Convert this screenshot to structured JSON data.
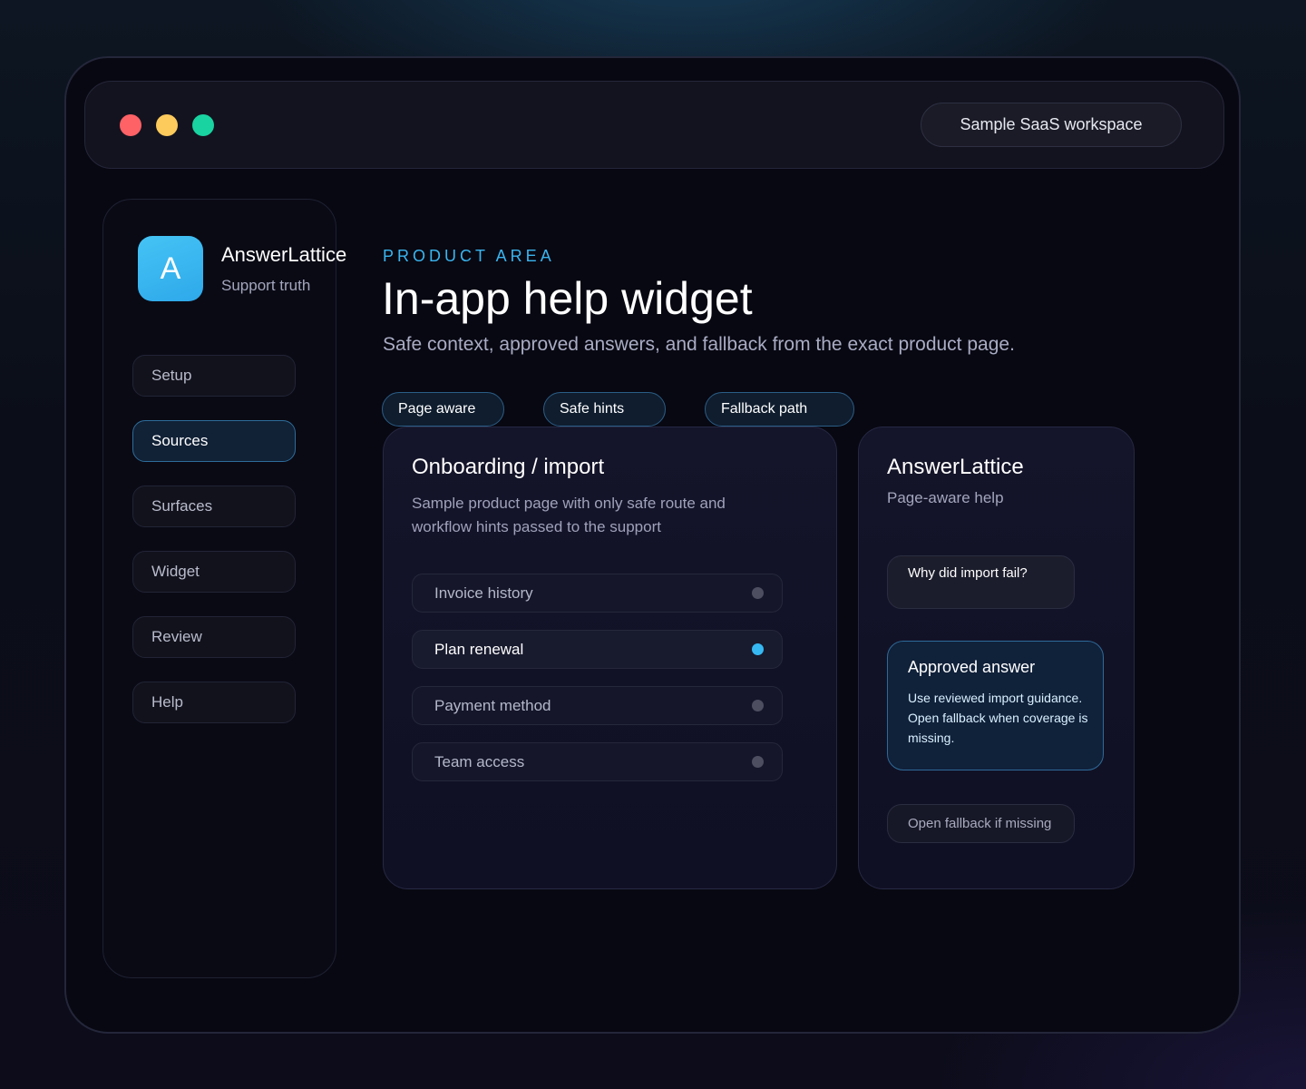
{
  "titlebar": {
    "workspace": "Sample SaaS workspace"
  },
  "brand": {
    "initial": "A",
    "name": "AnswerLattice",
    "tagline": "Support truth"
  },
  "nav": {
    "items": [
      {
        "label": "Setup",
        "active": false
      },
      {
        "label": "Sources",
        "active": true
      },
      {
        "label": "Surfaces",
        "active": false
      },
      {
        "label": "Widget",
        "active": false
      },
      {
        "label": "Review",
        "active": false
      },
      {
        "label": "Help",
        "active": false
      }
    ]
  },
  "header": {
    "eyebrow": "PRODUCT AREA",
    "title": "In-app help widget",
    "subtitle": "Safe context, approved answers, and fallback from the exact product page."
  },
  "chips": [
    "Page aware",
    "Safe hints",
    "Fallback path"
  ],
  "product_card": {
    "title": "Onboarding / import",
    "description": "Sample product page with only safe route and workflow hints passed to the support",
    "rows": [
      {
        "label": "Invoice history",
        "active": false
      },
      {
        "label": "Plan renewal",
        "active": true
      },
      {
        "label": "Payment method",
        "active": false
      },
      {
        "label": "Team access",
        "active": false
      }
    ]
  },
  "widget": {
    "title": "AnswerLattice",
    "subtitle": "Page-aware help",
    "question": "Why did import fail?",
    "answer_title": "Approved answer",
    "answer_body": "Use reviewed import guidance. Open fallback when coverage is missing.",
    "fallback_label": "Open fallback if missing"
  },
  "colors": {
    "accent": "#3ab5ef",
    "dot_red": "#fe6166",
    "dot_yellow": "#fdca5c",
    "dot_green": "#19d3a0"
  }
}
